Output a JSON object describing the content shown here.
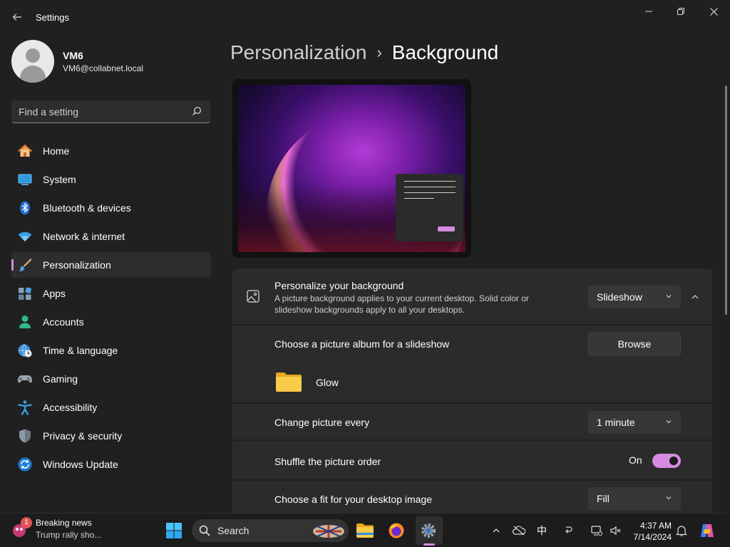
{
  "window": {
    "title": "Settings"
  },
  "profile": {
    "name": "VM6",
    "email": "VM6@collabnet.local"
  },
  "search": {
    "placeholder": "Find a setting"
  },
  "sidebar": {
    "items": [
      {
        "label": "Home",
        "icon": "home-icon"
      },
      {
        "label": "System",
        "icon": "system-icon"
      },
      {
        "label": "Bluetooth & devices",
        "icon": "bluetooth-icon"
      },
      {
        "label": "Network & internet",
        "icon": "wifi-icon"
      },
      {
        "label": "Personalization",
        "icon": "brush-icon",
        "active": true
      },
      {
        "label": "Apps",
        "icon": "apps-icon"
      },
      {
        "label": "Accounts",
        "icon": "accounts-icon"
      },
      {
        "label": "Time & language",
        "icon": "globe-clock-icon"
      },
      {
        "label": "Gaming",
        "icon": "gamepad-icon"
      },
      {
        "label": "Accessibility",
        "icon": "accessibility-icon"
      },
      {
        "label": "Privacy & security",
        "icon": "shield-icon"
      },
      {
        "label": "Windows Update",
        "icon": "update-icon"
      }
    ]
  },
  "breadcrumb": {
    "parent": "Personalization",
    "separator": "›",
    "current": "Background"
  },
  "background": {
    "title": "Personalize your background",
    "description": "A picture background applies to your current desktop. Solid color or slideshow backgrounds apply to all your desktops.",
    "value": "Slideshow",
    "album_label": "Choose a picture album for a slideshow",
    "browse_label": "Browse",
    "album_name": "Glow",
    "interval_label": "Change picture every",
    "interval_value": "1 minute",
    "shuffle_label": "Shuffle the picture order",
    "shuffle_state": "On",
    "fit_label": "Choose a fit for your desktop image",
    "fit_value": "Fill"
  },
  "taskbar": {
    "news_badge": "1",
    "news_title": "Breaking news",
    "news_subtitle": "Trump rally sho...",
    "search_label": "Search",
    "time": "4:37 AM",
    "date": "7/14/2024"
  },
  "colors": {
    "accent": "#d58ce0",
    "background": "#202020",
    "card": "#2b2b2b"
  }
}
